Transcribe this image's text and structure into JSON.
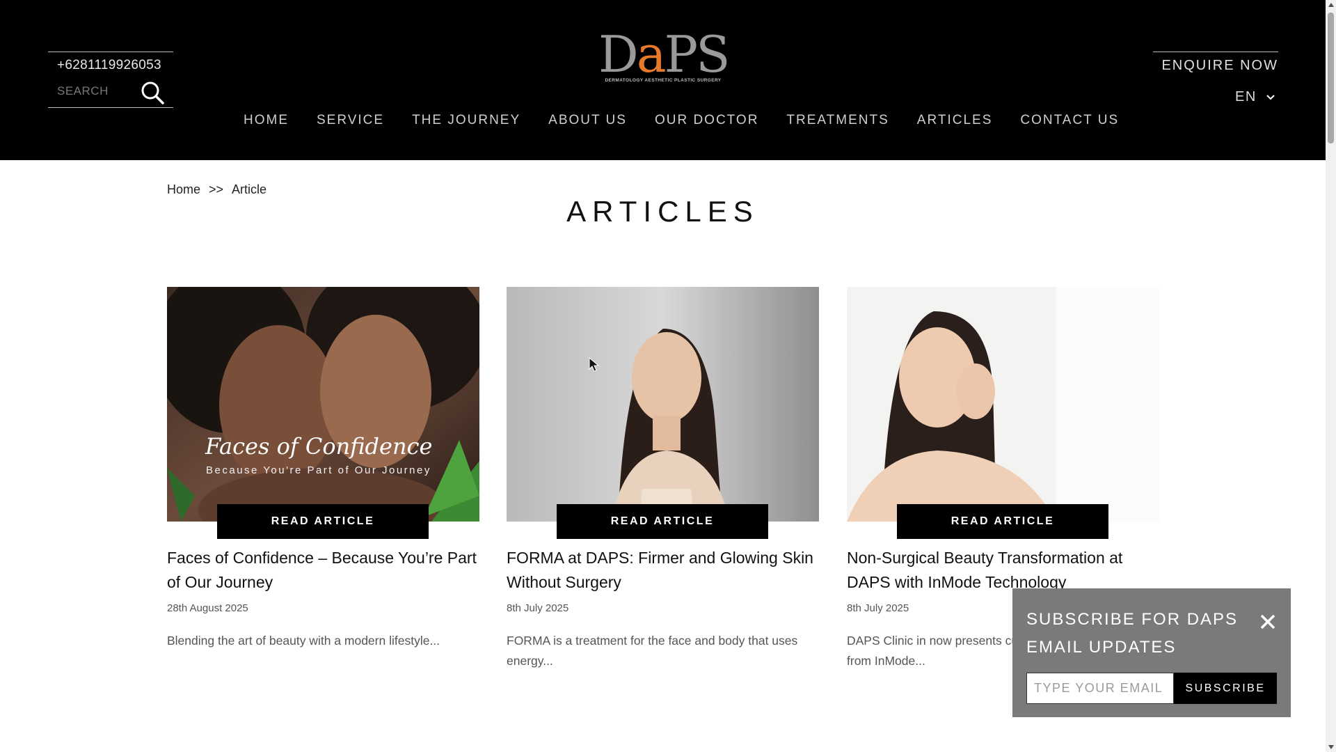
{
  "header": {
    "phone": "+6281119926053",
    "search_placeholder": "SEARCH",
    "logo": {
      "wordmark_prefix": "D",
      "wordmark_accent": "a",
      "wordmark_suffix": "PS",
      "tagline": "DERMATOLOGY AESTHETIC PLASTIC SURGERY"
    },
    "nav": [
      "HOME",
      "SERVICE",
      "THE JOURNEY",
      "ABOUT US",
      "OUR DOCTOR",
      "TREATMENTS",
      "ARTICLES",
      "CONTACT US"
    ],
    "enquire": "ENQUIRE NOW",
    "language": "EN"
  },
  "breadcrumb": {
    "home": "Home",
    "separator": ">>",
    "current": "Article"
  },
  "page_title": "ARTICLES",
  "articles": [
    {
      "button": "READ ARTICLE",
      "title": "Faces of Confidence – Because You’re Part of Our Journey",
      "date": "28th August 2025",
      "excerpt": "Blending the art of beauty with a modern lifestyle...",
      "image_overlay_title": "Faces of Confidence",
      "image_overlay_subtitle": "Because You're Part of Our Journey"
    },
    {
      "button": "READ ARTICLE",
      "title": "FORMA at DAPS: Firmer and Glowing Skin Without Surgery",
      "date": "8th July 2025",
      "excerpt": "FORMA is a treatment for the face and body that uses energy..."
    },
    {
      "button": "READ ARTICLE",
      "title": "Non-Surgical Beauty Transformation at DAPS with InMode Technology",
      "date": "8th July 2025",
      "excerpt": "DAPS Clinic in now presents cutting-edge technology from InMode..."
    }
  ],
  "subscribe": {
    "title": "SUBSCRIBE FOR DAPS EMAIL UPDATES",
    "email_placeholder": "TYPE YOUR EMAIL",
    "button": "SUBSCRIBE"
  },
  "colors": {
    "header_bg": "#000000",
    "logo_accent": "#e8782a",
    "popup_bg": "#7a7a7a"
  }
}
